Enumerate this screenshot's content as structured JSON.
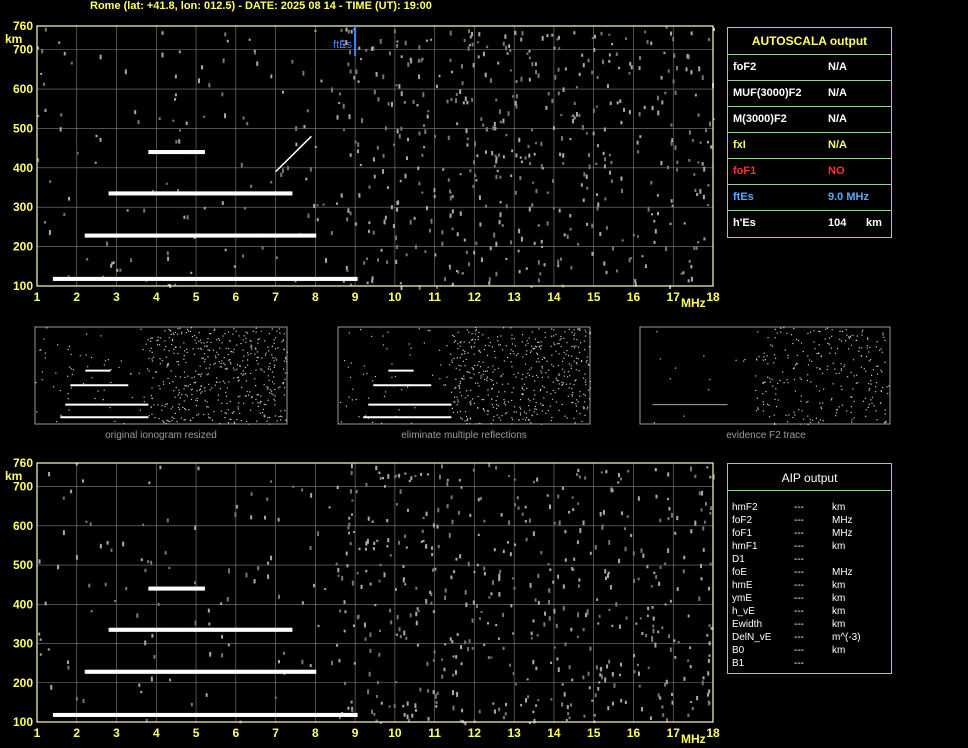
{
  "header": "Rome (lat: +41.8, lon: 012.5) - DATE: 2025 08 14 - TIME (UT): 19:00",
  "colors": {
    "axis": "#ffffcc",
    "grid": "#808080",
    "trace": "#ffffff",
    "es": "#4488ff",
    "label": "#ffff66",
    "red": "#ff3030",
    "blue": "#55aaff",
    "border": "#9acd9a"
  },
  "chart_data": [
    {
      "type": "scatter",
      "title": "",
      "xlabel": "MHz",
      "ylabel": "km",
      "xlim": [
        1,
        18
      ],
      "ylim": [
        100,
        760
      ],
      "x_ticks": [
        "1",
        "2",
        "3",
        "4",
        "5",
        "6",
        "7",
        "8",
        "9",
        "10",
        "11",
        "12",
        "13",
        "14",
        "15",
        "16",
        "17",
        "18"
      ],
      "y_ticks": [
        "100",
        "200",
        "300",
        "400",
        "500",
        "600",
        "700",
        "760"
      ],
      "grid": true,
      "annotations": [
        {
          "text": "ftEs",
          "x": 9.0
        }
      ],
      "traces": [
        {
          "name": "",
          "x_start": 1.4,
          "x_end": 9.0,
          "y": 118
        },
        {
          "name": "",
          "x_start": 2.2,
          "x_end": 8.0,
          "y": 228
        },
        {
          "name": "",
          "x_start": 2.8,
          "x_end": 7.4,
          "y": 335
        },
        {
          "name": "",
          "x_start": 3.8,
          "x_end": 5.2,
          "y": 440
        },
        {
          "name": "",
          "x_start": 7.0,
          "x_end": 7.9,
          "y_start": 390,
          "y_end": 480
        }
      ]
    },
    {
      "type": "scatter",
      "title": "",
      "xlabel": "MHz",
      "ylabel": "km",
      "xlim": [
        1,
        18
      ],
      "ylim": [
        100,
        760
      ],
      "x_ticks": [
        "1",
        "2",
        "3",
        "4",
        "5",
        "6",
        "7",
        "8",
        "9",
        "10",
        "11",
        "12",
        "13",
        "14",
        "15",
        "16",
        "17",
        "18"
      ],
      "y_ticks": [
        "100",
        "200",
        "300",
        "400",
        "500",
        "600",
        "700",
        "760"
      ],
      "grid": true,
      "traces": [
        {
          "name": "",
          "x_start": 1.4,
          "x_end": 9.0,
          "y": 118
        },
        {
          "name": "",
          "x_start": 2.2,
          "x_end": 8.0,
          "y": 228
        },
        {
          "name": "",
          "x_start": 2.8,
          "x_end": 7.4,
          "y": 335
        },
        {
          "name": "",
          "x_start": 3.8,
          "x_end": 5.2,
          "y": 440
        }
      ]
    }
  ],
  "thumbnails": [
    {
      "caption": "original ionogram resized"
    },
    {
      "caption": "eliminate multiple reflections"
    },
    {
      "caption": "evidence F2 trace"
    }
  ],
  "autoscala": {
    "title": "AUTOSCALA output",
    "rows": [
      {
        "label": "foF2",
        "value": "N/A",
        "unit": "",
        "color": "#ffffff"
      },
      {
        "label": "MUF(3000)F2",
        "value": "N/A",
        "unit": "",
        "color": "#ffffff"
      },
      {
        "label": "M(3000)F2",
        "value": "N/A",
        "unit": "",
        "color": "#ffffff"
      },
      {
        "label": "fxI",
        "value": "N/A",
        "unit": "",
        "color": "#ffff66"
      },
      {
        "label": "foF1",
        "value": "NO",
        "unit": "",
        "color": "#ff3030"
      },
      {
        "label": "ftEs",
        "value": "9.0 MHz",
        "unit": "",
        "color": "#55aaff"
      },
      {
        "label": "h'Es",
        "value": "104",
        "unit": "km",
        "color": "#ffffff"
      }
    ]
  },
  "aip": {
    "title": "AIP output",
    "rows": [
      {
        "label": "hmF2",
        "value": "---",
        "unit": "km"
      },
      {
        "label": "foF2",
        "value": "---",
        "unit": "MHz"
      },
      {
        "label": "foF1",
        "value": "---",
        "unit": "MHz"
      },
      {
        "label": "hmF1",
        "value": "---",
        "unit": "km"
      },
      {
        "label": "D1",
        "value": "---",
        "unit": ""
      },
      {
        "label": "foE",
        "value": "---",
        "unit": "MHz"
      },
      {
        "label": "hmE",
        "value": "---",
        "unit": "km"
      },
      {
        "label": "ymE",
        "value": "---",
        "unit": "km"
      },
      {
        "label": "h_vE",
        "value": "---",
        "unit": "km"
      },
      {
        "label": "Ewidth",
        "value": "---",
        "unit": "km"
      },
      {
        "label": "DelN_vE",
        "value": "---",
        "unit": "m^(-3)"
      },
      {
        "label": "B0",
        "value": "---",
        "unit": "km"
      },
      {
        "label": "B1",
        "value": "---",
        "unit": ""
      }
    ]
  }
}
